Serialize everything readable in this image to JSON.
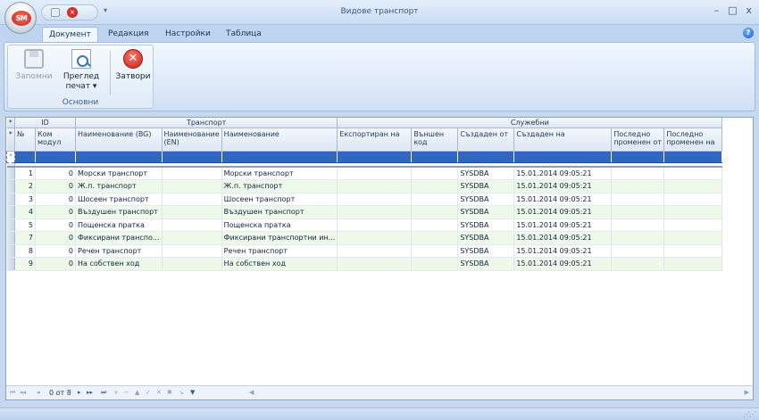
{
  "app": {
    "logo_text": "SM",
    "title": "Видове транспорт",
    "qat_more": "▾"
  },
  "window_controls": {
    "minimize": "–",
    "maximize": "□",
    "close": "x"
  },
  "ribbon": {
    "tabs": [
      {
        "label": "Документ",
        "active": true
      },
      {
        "label": "Редакция",
        "active": false
      },
      {
        "label": "Настройки",
        "active": false
      },
      {
        "label": "Таблица",
        "active": false
      }
    ],
    "group_label": "Основни",
    "buttons": {
      "save": "Запомни",
      "preview": "Преглед печат ▾",
      "close": "Затвори"
    },
    "help": "?"
  },
  "grid": {
    "bands": {
      "id": "ID",
      "transport": "Транспорт",
      "service": "Служебни"
    },
    "columns": [
      "№",
      "Ком модул",
      "Наименование (BG)",
      "Наименование (EN)",
      "Наименование",
      "Експортиран на",
      "Външен код",
      "Създаден от",
      "Създаден на",
      "Последно променен от",
      "Последно променен на"
    ],
    "indicator_glyph": "*",
    "rows": [
      {
        "no": "1",
        "mod": "0",
        "bg": "Морски транспорт",
        "en": "",
        "name": "Морски транспорт",
        "exp": "",
        "ext": "",
        "by": "SYSDBA",
        "on": "15.01.2014 09:05:21",
        "mby": "",
        "mon": ""
      },
      {
        "no": "2",
        "mod": "0",
        "bg": "Ж.п. транспорт",
        "en": "",
        "name": "Ж.п. транспорт",
        "exp": "",
        "ext": "",
        "by": "SYSDBA",
        "on": "15.01.2014 09:05:21",
        "mby": "",
        "mon": ""
      },
      {
        "no": "3",
        "mod": "0",
        "bg": "Шосеен транспорт",
        "en": "",
        "name": "Шосеен транспорт",
        "exp": "",
        "ext": "",
        "by": "SYSDBA",
        "on": "15.01.2014 09:05:21",
        "mby": "",
        "mon": ""
      },
      {
        "no": "4",
        "mod": "0",
        "bg": "Въздушен транспорт",
        "en": "",
        "name": "Въздушен транспорт",
        "exp": "",
        "ext": "",
        "by": "SYSDBA",
        "on": "15.01.2014 09:05:21",
        "mby": "",
        "mon": ""
      },
      {
        "no": "5",
        "mod": "0",
        "bg": "Пощенска пратка",
        "en": "",
        "name": "Пощенска пратка",
        "exp": "",
        "ext": "",
        "by": "SYSDBA",
        "on": "15.01.2014 09:05:21",
        "mby": "",
        "mon": ""
      },
      {
        "no": "7",
        "mod": "0",
        "bg": "Фиксирани транспо...",
        "en": "",
        "name": "Фиксирани транспортни ин...",
        "exp": "",
        "ext": "",
        "by": "SYSDBA",
        "on": "15.01.2014 09:05:21",
        "mby": "",
        "mon": ""
      },
      {
        "no": "8",
        "mod": "0",
        "bg": "Речен транспорт",
        "en": "",
        "name": "Речен транспорт",
        "exp": "",
        "ext": "",
        "by": "SYSDBA",
        "on": "15.01.2014 09:05:21",
        "mby": "",
        "mon": ""
      },
      {
        "no": "9",
        "mod": "0",
        "bg": "На собствен ход",
        "en": "",
        "name": "На собствен ход",
        "exp": "",
        "ext": "",
        "by": "SYSDBA",
        "on": "15.01.2014 09:05:21",
        "mby": "",
        "mon": ""
      }
    ]
  },
  "navigator": {
    "first": "⏮",
    "prev_page": "◂◂",
    "prev": "◂",
    "record_count": "0 от 8",
    "next": "▸",
    "next_page": "▸▸",
    "last": "⏭",
    "append": "+",
    "delete": "−",
    "edit": "▲",
    "end_edit": "✓",
    "cancel_edit": "✕",
    "bookmark": "✱",
    "goto": "↘",
    "filter": "▼"
  },
  "scroll": {
    "left": "◀",
    "right": "▶"
  },
  "status": {
    "grip": "⋰⋰"
  }
}
